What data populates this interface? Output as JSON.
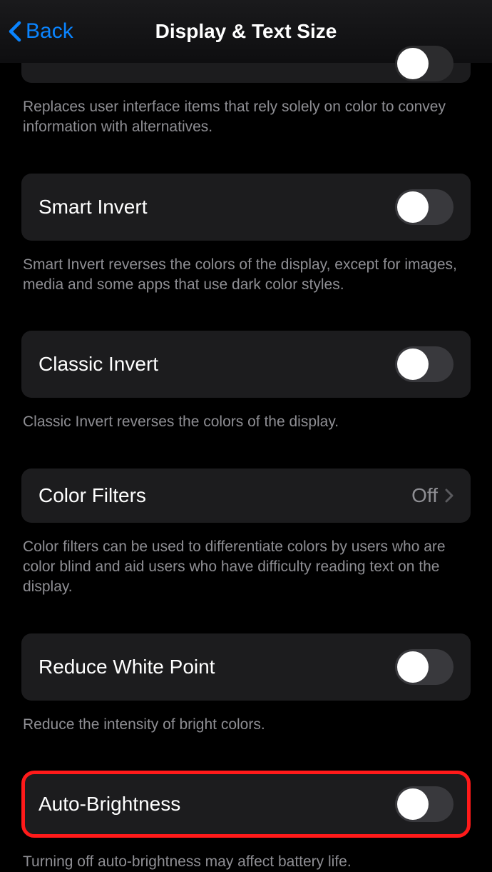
{
  "nav": {
    "back_label": "Back",
    "title": "Display & Text Size"
  },
  "sections": {
    "differentiate_footer": "Replaces user interface items that rely solely on color to convey information with alternatives.",
    "smart_invert": {
      "label": "Smart Invert",
      "footer": "Smart Invert reverses the colors of the display, except for images, media and some apps that use dark color styles."
    },
    "classic_invert": {
      "label": "Classic Invert",
      "footer": "Classic Invert reverses the colors of the display."
    },
    "color_filters": {
      "label": "Color Filters",
      "value": "Off",
      "footer": "Color filters can be used to differentiate colors by users who are color blind and aid users who have difficulty reading text on the display."
    },
    "reduce_white_point": {
      "label": "Reduce White Point",
      "footer": "Reduce the intensity of bright colors."
    },
    "auto_brightness": {
      "label": "Auto-Brightness",
      "footer": "Turning off auto-brightness may affect battery life."
    }
  }
}
